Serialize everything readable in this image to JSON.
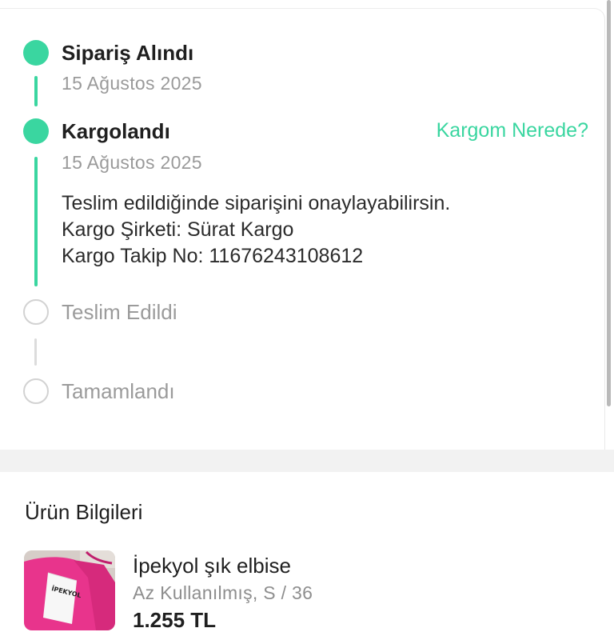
{
  "timeline": {
    "steps": [
      {
        "title": "Sipariş Alındı",
        "date": "15 Ağustos 2025",
        "status": "done"
      },
      {
        "title": "Kargolandı",
        "date": "15 Ağustos 2025",
        "status": "done",
        "action_label": "Kargom Nerede?",
        "note_lines": [
          "Teslim edildiğinde siparişini onaylayabilirsin.",
          "Kargo Şirketi: Sürat Kargo",
          "Kargo Takip No: 11676243108612"
        ]
      },
      {
        "title": "Teslim Edildi",
        "status": "pending"
      },
      {
        "title": "Tamamlandı",
        "status": "pending"
      }
    ]
  },
  "product_section": {
    "title": "Ürün Bilgileri",
    "product": {
      "name": "İpekyol şık elbise",
      "meta": "Az Kullanılmış, S / 36",
      "price": "1.255 TL",
      "label_text": "İPEKYOL"
    }
  },
  "colors": {
    "accent": "#3ad6a0",
    "pending": "#d2d2d2",
    "text": "#1f1f1f",
    "muted": "#9a9a9a"
  }
}
